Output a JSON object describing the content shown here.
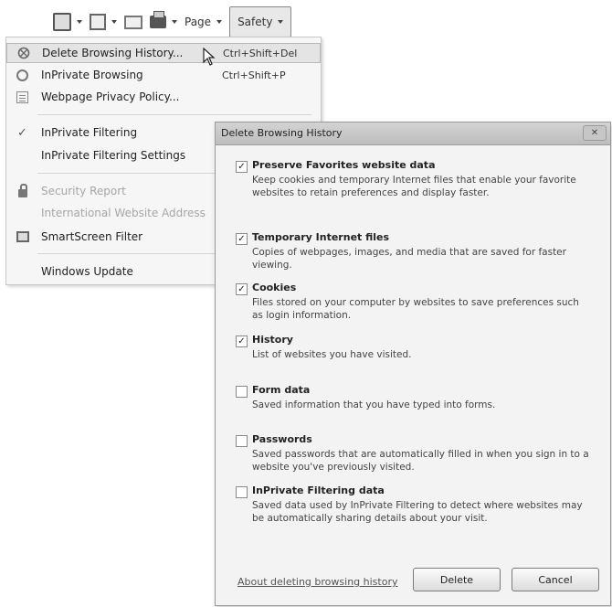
{
  "toolbar": {
    "page_label": "Page",
    "safety_label": "Safety"
  },
  "menu": {
    "items": [
      {
        "label": "Delete Browsing History...",
        "shortcut": "Ctrl+Shift+Del",
        "icon": "delete-history-icon"
      },
      {
        "label": "InPrivate Browsing",
        "shortcut": "Ctrl+Shift+P",
        "icon": "inprivate-icon"
      },
      {
        "label": "Webpage Privacy Policy...",
        "shortcut": "",
        "icon": "privacy-policy-icon"
      },
      {
        "label": "InPrivate Filtering",
        "shortcut": "",
        "icon": "check-icon"
      },
      {
        "label": "InPrivate Filtering Settings",
        "shortcut": "",
        "icon": ""
      },
      {
        "label": "Security Report",
        "shortcut": "",
        "icon": "lock-icon",
        "disabled": true
      },
      {
        "label": "International Website Address",
        "shortcut": "",
        "icon": "",
        "disabled": true
      },
      {
        "label": "SmartScreen Filter",
        "shortcut": "",
        "icon": "smartscreen-icon"
      },
      {
        "label": "Windows Update",
        "shortcut": "",
        "icon": ""
      }
    ]
  },
  "dialog": {
    "title": "Delete Browsing History",
    "close_glyph": "✕",
    "options": [
      {
        "title": "Preserve Favorites website data",
        "desc": "Keep cookies and temporary Internet files that enable your favorite websites to retain preferences and display faster.",
        "checked": true
      },
      {
        "title": "Temporary Internet files",
        "desc": "Copies of webpages, images, and media that are saved for faster viewing.",
        "checked": true
      },
      {
        "title": "Cookies",
        "desc": "Files stored on your computer by websites to save preferences such as login information.",
        "checked": true
      },
      {
        "title": "History",
        "desc": "List of websites you have visited.",
        "checked": true
      },
      {
        "title": "Form data",
        "desc": "Saved information that you have typed into forms.",
        "checked": false
      },
      {
        "title": "Passwords",
        "desc": "Saved passwords that are automatically filled in when you sign in to a website you've previously visited.",
        "checked": false
      },
      {
        "title": "InPrivate Filtering data",
        "desc": "Saved data used by InPrivate Filtering to detect where websites may be automatically sharing details about your visit.",
        "checked": false
      }
    ],
    "link_label": "About deleting browsing history",
    "delete_label": "Delete",
    "cancel_label": "Cancel"
  }
}
